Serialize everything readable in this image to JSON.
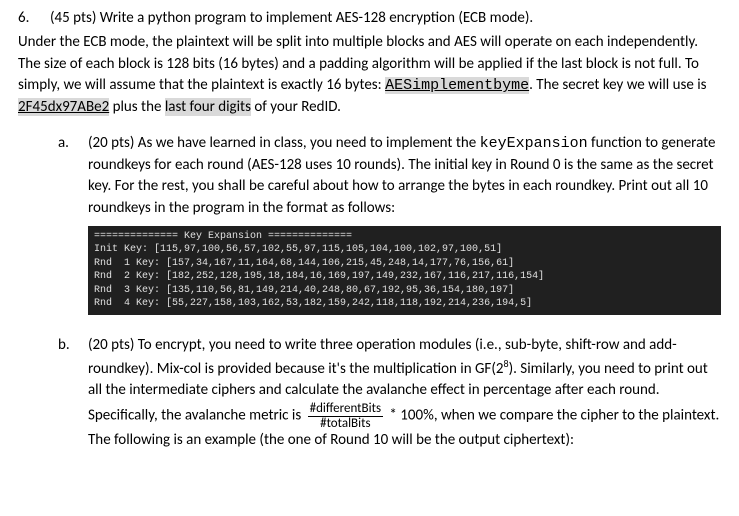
{
  "q": {
    "num": "6.",
    "pts": "(45 pts) Write a python program to implement AES-128 encryption (ECB mode).",
    "body1": "Under the ECB mode, the plaintext will be split into multiple blocks and AES will operate on each independently. The size of each block is 128 bits (16 bytes) and a padding algorithm will be applied if the last block is not full. To simply, we will assume that the plaintext is exactly 16 bytes: ",
    "pt": "AESimplementbyme",
    "body2": ". The secret key we will use is ",
    "key": "2F45dx97ABe2",
    "body3": " plus the ",
    "last4": "last four digits",
    "body4": " of your RedID."
  },
  "a": {
    "letter": "a.",
    "intro": "(20 pts) As we have learned in class, you need to implement the ",
    "fn": "keyExpansion",
    "tail": " function to generate roundkeys for each round (AES-128 uses 10 rounds). The initial key in Round 0 is the same as the secret key. For the rest, you shall be careful about how to arrange the bytes in each roundkey. Print out all 10 roundkeys in the program in the format as follows:",
    "code": "============== Key Expansion ==============\nInit Key: [115,97,100,56,57,102,55,97,115,105,104,100,102,97,100,51]\nRnd  1 Key: [157,34,167,11,164,68,144,106,215,45,248,14,177,76,156,61]\nRnd  2 Key: [182,252,128,195,18,184,16,169,197,149,232,167,116,217,116,154]\nRnd  3 Key: [135,110,56,81,149,214,40,248,80,67,192,95,36,154,180,197]\nRnd  4 Key: [55,227,158,103,162,53,182,159,242,118,118,192,214,236,194,5]"
  },
  "b": {
    "letter": "b.",
    "p1": "(20 pts) To encrypt, you need to write three operation modules (i.e., sub-byte, shift-row and add-roundkey). Mix-col is provided because it's the multiplication in ",
    "gf": "GF(2",
    "exp": "8",
    "gf2": ")",
    "p2": ". Similarly, you need to print out all the intermediate ciphers and calculate the avalanche effect in percentage after each round. Specifically, the avalanche metric is ",
    "fracTop": "#differentBits",
    "fracBot": "#totalBits",
    "p3": " * 100%, when we compare the cipher to the plaintext. The following is an example (the one of Round 10 will be the output ciphertext):"
  }
}
